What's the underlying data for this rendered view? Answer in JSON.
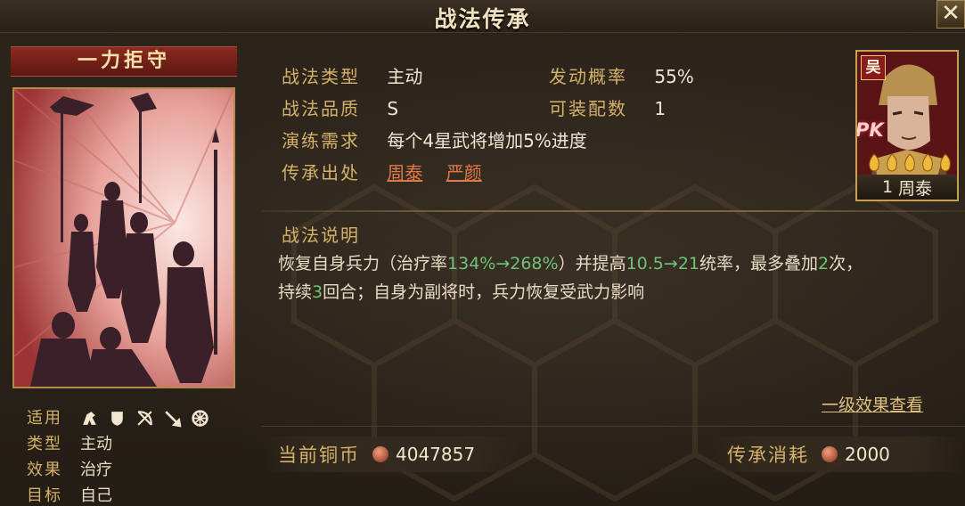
{
  "window": {
    "title": "战法传承",
    "close_label": "✕"
  },
  "skill": {
    "name": "一力拒守",
    "info": {
      "type_label": "战法类型",
      "type_value": "主动",
      "rate_label": "发动概率",
      "rate_value": "55%",
      "quality_label": "战法品质",
      "quality_value": "S",
      "slots_label": "可装配数",
      "slots_value": "1",
      "drill_label": "演练需求",
      "drill_value": "每个4星武将增加5%进度",
      "source_label": "传承出处",
      "sources": [
        "周泰",
        "严颜"
      ]
    },
    "description": {
      "title": "战法说明",
      "p1": "恢复自身兵力（治疗率",
      "g1": "134%→268%",
      "p2": "）并提高",
      "g2": "10.5→21",
      "p3": "统率，最多叠加",
      "g3": "2",
      "p4": "次，",
      "p5": "持续",
      "g4": "3",
      "p6": "回合；自身为副将时，兵力恢复受武力影响"
    },
    "effect_link": "一级效果查看",
    "tags": {
      "apply_label": "适用",
      "apply_icons": [
        "cavalry-icon",
        "shield-icon",
        "bow-icon",
        "spear-icon",
        "wheel-icon"
      ],
      "type_label": "类型",
      "type_value": "主动",
      "effect_label": "效果",
      "effect_value": "治疗",
      "target_label": "目标",
      "target_value": "自己"
    }
  },
  "general": {
    "faction": "吴",
    "badge": "PK",
    "stars": 5,
    "level": "1",
    "name": "周泰"
  },
  "footer": {
    "coins_label": "当前铜币",
    "coins_value": "4047857",
    "cost_label": "传承消耗",
    "cost_value": "2000"
  },
  "colors": {
    "accent_gold": "#d4b06a",
    "highlight_green": "#6fc27a",
    "link_orange": "#e07a48"
  }
}
